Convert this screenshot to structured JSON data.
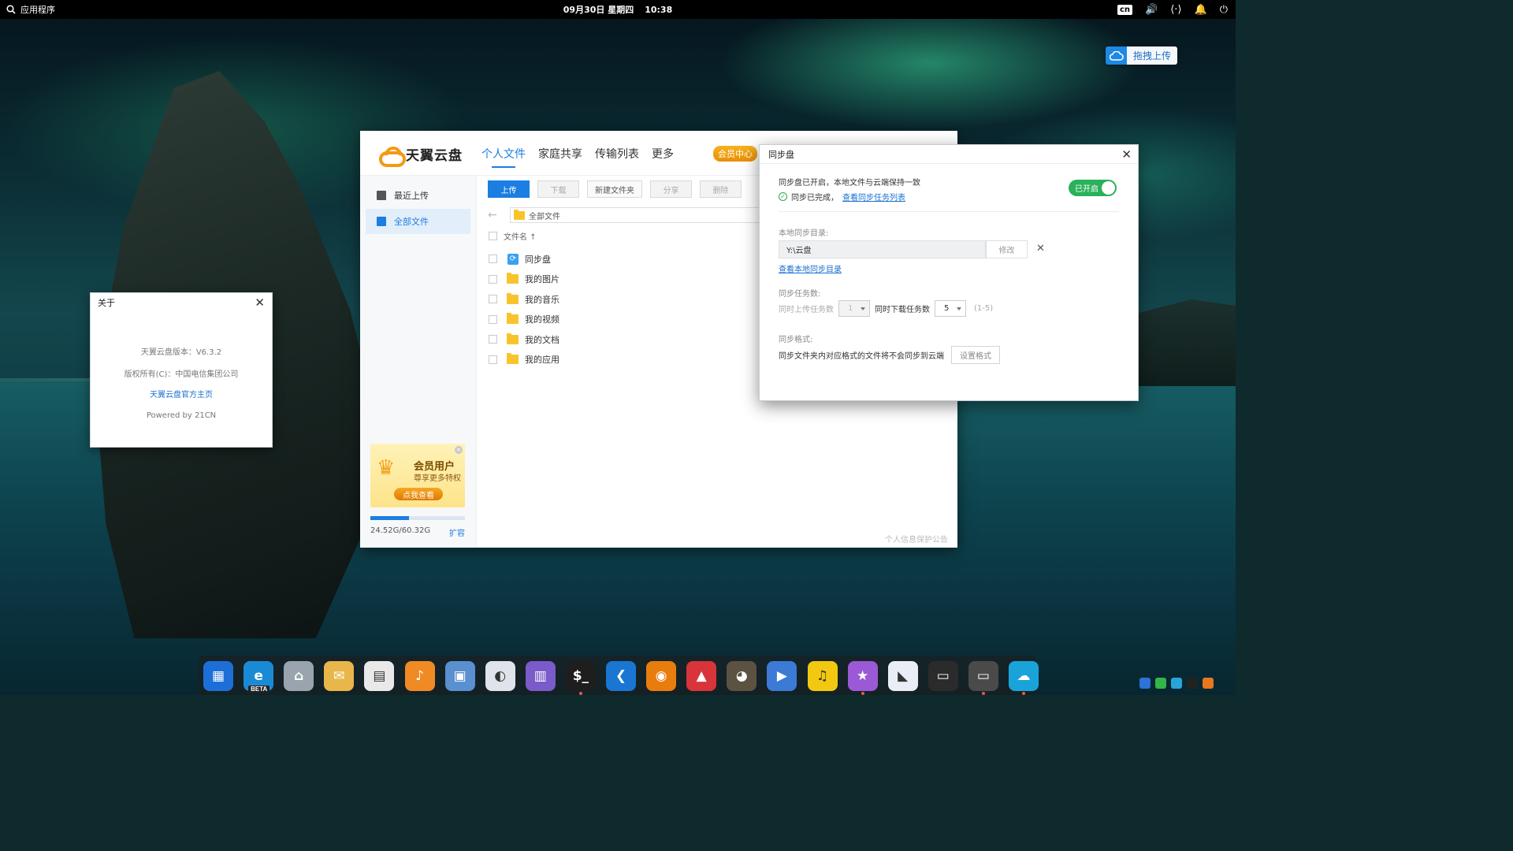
{
  "topbar": {
    "apps_label": "应用程序",
    "date": "09月30日 星期四",
    "time": "10:38",
    "ime": "cn"
  },
  "drag_upload": {
    "label": "拖拽上传"
  },
  "main_window": {
    "app_name": "天翼云盘",
    "nav": [
      "个人文件",
      "家庭共享",
      "传输列表",
      "更多"
    ],
    "vip_button": "会员中心",
    "sidebar": [
      {
        "label": "最近上传"
      },
      {
        "label": "全部文件"
      }
    ],
    "promo": {
      "title": "会员用户",
      "subtitle": "尊享更多特权",
      "button": "点我查看"
    },
    "quota": {
      "text": "24.52G/60.32G",
      "expand": "扩容",
      "used_fraction": 0.41
    },
    "toolbar": [
      "上传",
      "下载",
      "新建文件夹",
      "分享",
      "删除"
    ],
    "path": "全部文件",
    "column_header": "文件名 ↑",
    "files": [
      "同步盘",
      "我的图片",
      "我的音乐",
      "我的视频",
      "我的文档",
      "我的应用"
    ],
    "privacy_notice": "个人信息保护公告"
  },
  "sync_dialog": {
    "title": "同步盘",
    "status_line": "同步盘已开启，本地文件与云端保持一致",
    "done_text": "同步已完成，",
    "task_list_link": "查看同步任务列表",
    "toggle_label": "已开启",
    "local_dir_label": "本地同步目录:",
    "local_dir_value": "Y:\\云盘",
    "modify_button": "修改",
    "view_local_link": "查看本地同步目录",
    "task_count_label": "同步任务数:",
    "upload_tasks_label": "同时上传任务数",
    "upload_tasks_value": "1",
    "download_tasks_label": "同时下载任务数",
    "download_tasks_value": "5",
    "range": "(1-5)",
    "format_label": "同步格式:",
    "format_desc": "同步文件夹内对应格式的文件将不会同步到云端",
    "format_button": "设置格式"
  },
  "about_dialog": {
    "title": "关于",
    "version": "天翼云盘版本：V6.3.2",
    "copyright": "版权所有(C)：中国电信集团公司",
    "homepage_link": "天翼云盘官方主页",
    "powered": "Powered by 21CN"
  },
  "dock": {
    "beta_badge": "BETA",
    "icons": [
      "multitasking-view-icon",
      "edge-beta-browser-icon",
      "home-files-icon",
      "mail-icon",
      "calendar-icon",
      "music-icon",
      "image-viewer-icon",
      "control-center-icon",
      "app-store-icon",
      "terminal-icon",
      "vscode-icon",
      "blender-icon",
      "app-a-icon",
      "gimp-icon",
      "scrcpy-icon",
      "qq-music-icon",
      "star-app-icon",
      "feishu-icon",
      "deepin-terminal-icon",
      "display-icon",
      "tianyi-cloud-icon"
    ]
  }
}
